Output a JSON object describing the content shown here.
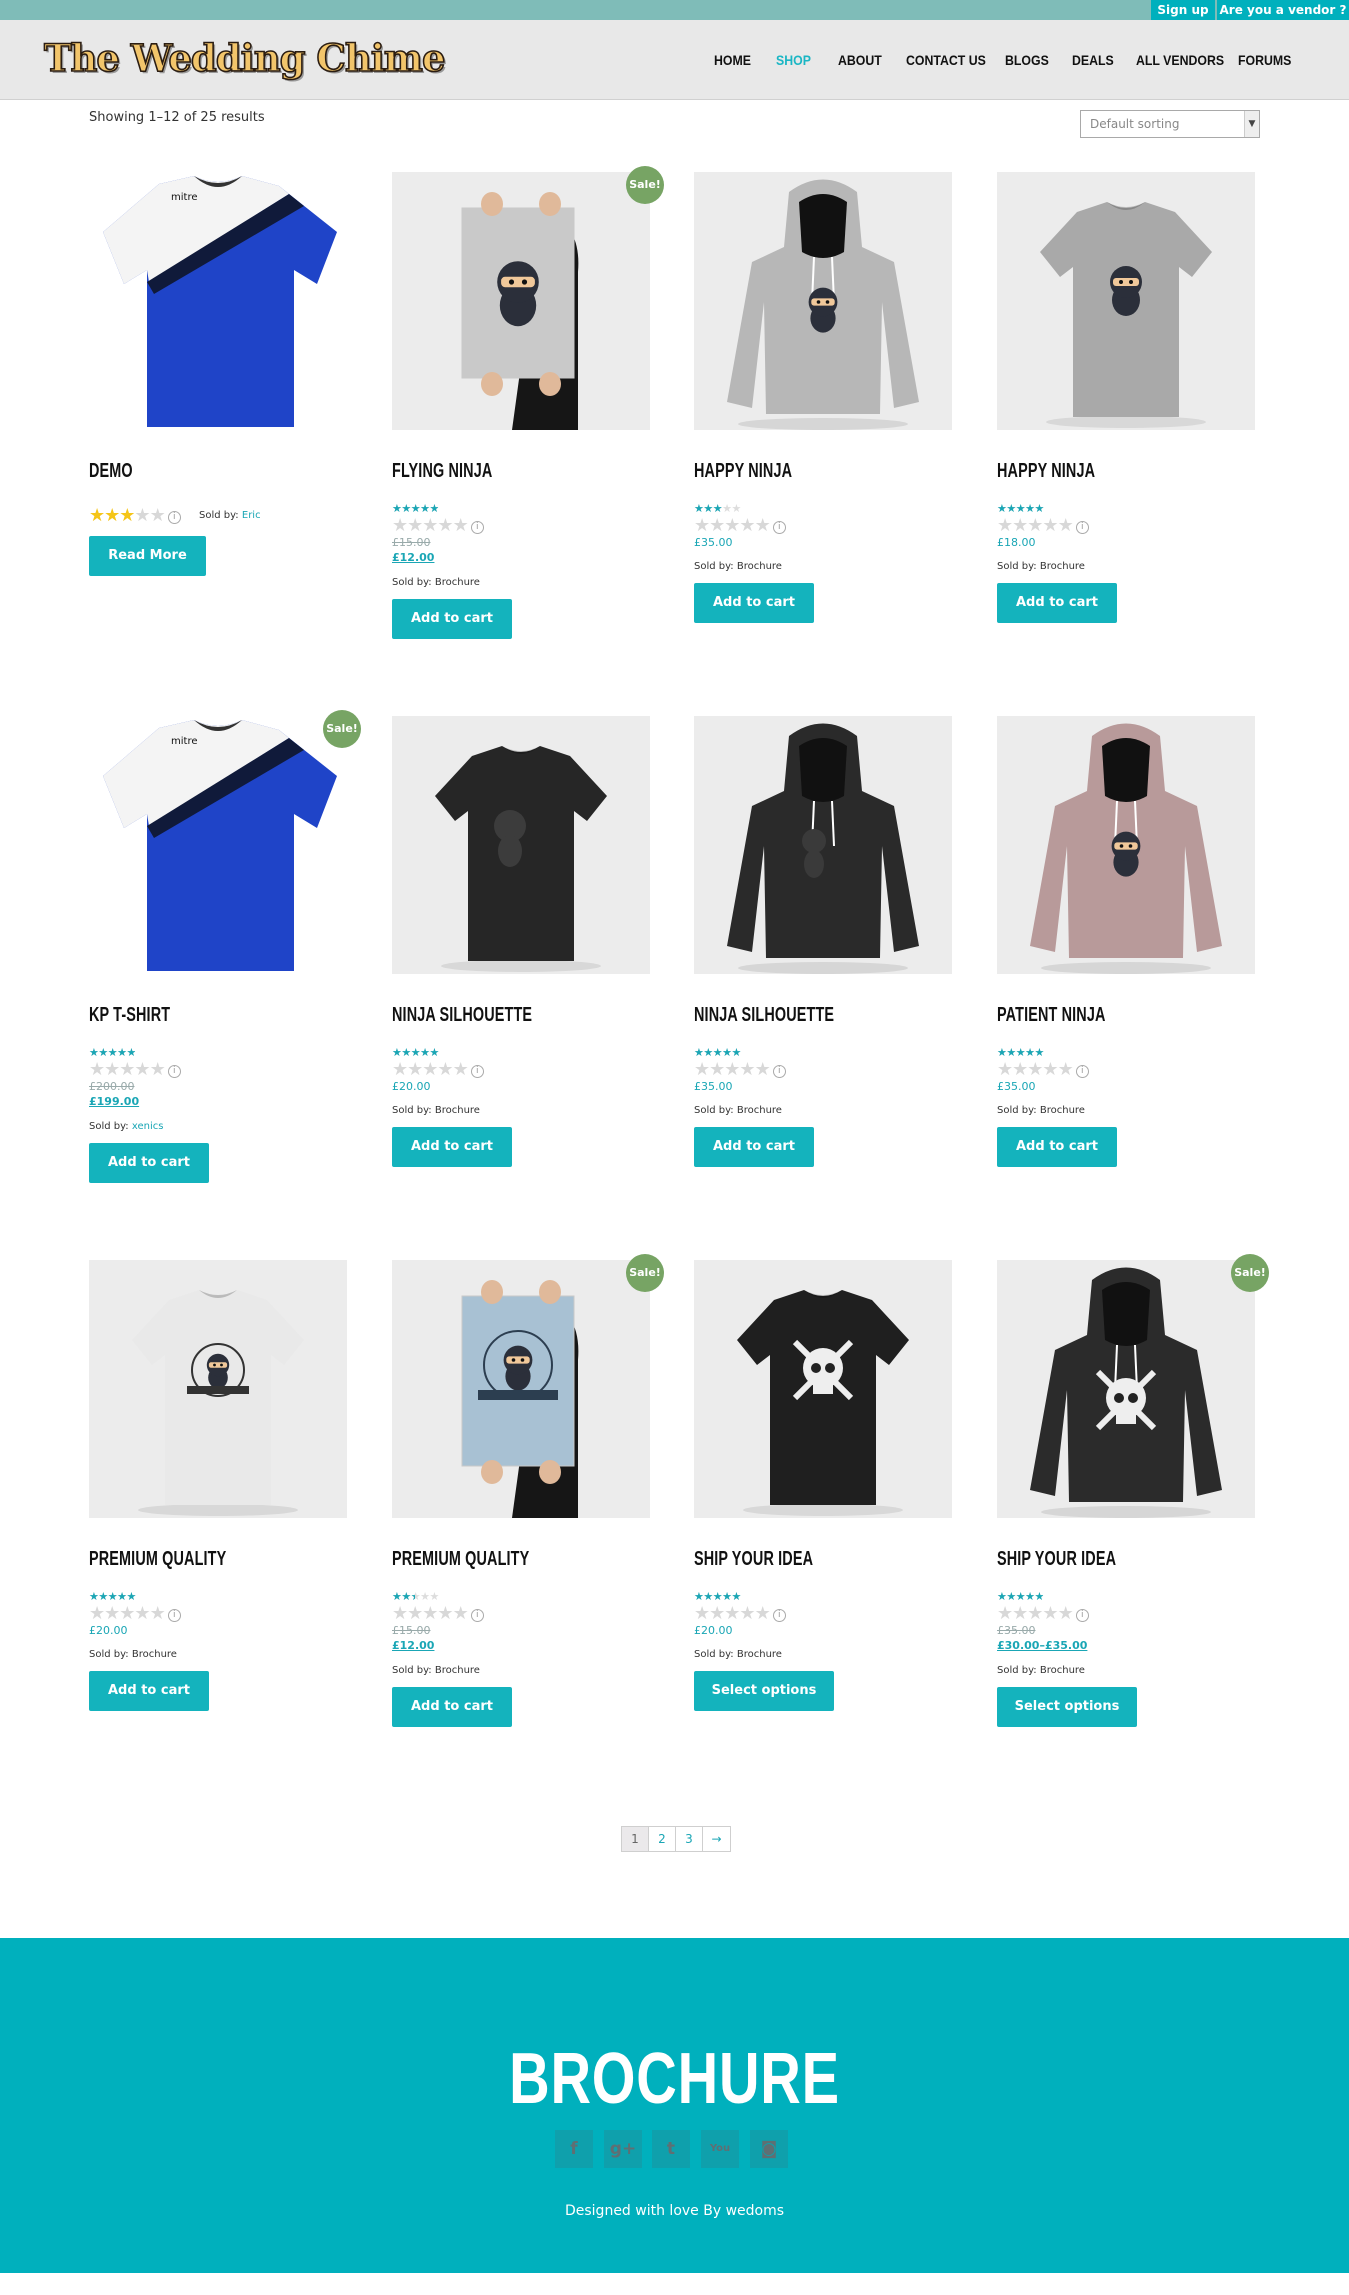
{
  "topbar": {
    "signup": "Sign up",
    "vendor": "Are you a vendor ?"
  },
  "brand": {
    "logo_text": "The Wedding Chime"
  },
  "nav": [
    {
      "label": "HOME",
      "active": false
    },
    {
      "label": "SHOP",
      "active": true
    },
    {
      "label": "ABOUT",
      "active": false
    },
    {
      "label": "CONTACT US",
      "active": false
    },
    {
      "label": "BLOGS",
      "active": false
    },
    {
      "label": "DEALS",
      "active": false
    },
    {
      "label": "ALL VENDORS",
      "active": false
    },
    {
      "label": "FORUMS",
      "active": false
    }
  ],
  "shop": {
    "result_count": "Showing 1–12 of 25 results",
    "sorting": {
      "selected": "Default sorting"
    },
    "sale_badge": "Sale!",
    "sold_by_prefix": "Sold by:"
  },
  "products": [
    {
      "title": "DEMO",
      "image": "blue-jersey",
      "sale": false,
      "rating": 3,
      "rating_style": "gold",
      "price_old": "",
      "price": "",
      "vendor": "Eric",
      "button": "Read More"
    },
    {
      "title": "FLYING NINJA",
      "image": "ninja-poster",
      "sale": true,
      "rating": 4,
      "price_old": "£15.00",
      "price": "£12.00",
      "vendor": "Brochure",
      "button": "Add to cart"
    },
    {
      "title": "HAPPY NINJA",
      "image": "grey-hoodie",
      "sale": false,
      "rating": 2.5,
      "price_old": "",
      "price": "£35.00",
      "vendor": "Brochure",
      "button": "Add to cart"
    },
    {
      "title": "HAPPY NINJA",
      "image": "grey-tshirt",
      "sale": false,
      "rating": 5,
      "price_old": "",
      "price": "£18.00",
      "vendor": "Brochure",
      "button": "Add to cart"
    },
    {
      "title": "KP T-SHIRT",
      "image": "blue-jersey",
      "sale": true,
      "rating": 4,
      "price_old": "£200.00",
      "price": "£199.00",
      "vendor": "xenics",
      "button": "Add to cart"
    },
    {
      "title": "NINJA SILHOUETTE",
      "image": "black-tshirt-ninja",
      "sale": false,
      "rating": 5,
      "price_old": "",
      "price": "£20.00",
      "vendor": "Brochure",
      "button": "Add to cart"
    },
    {
      "title": "NINJA SILHOUETTE",
      "image": "black-hoodie",
      "sale": false,
      "rating": 4.5,
      "price_old": "",
      "price": "£35.00",
      "vendor": "Brochure",
      "button": "Add to cart"
    },
    {
      "title": "PATIENT NINJA",
      "image": "pink-hoodie",
      "sale": false,
      "rating": 5,
      "price_old": "",
      "price": "£35.00",
      "vendor": "Brochure",
      "button": "Add to cart"
    },
    {
      "title": "PREMIUM QUALITY",
      "image": "white-tshirt",
      "sale": false,
      "rating": 4.5,
      "price_old": "",
      "price": "£20.00",
      "vendor": "Brochure",
      "button": "Add to cart"
    },
    {
      "title": "PREMIUM QUALITY",
      "image": "woo-poster",
      "sale": true,
      "rating": 2,
      "price_old": "£15.00",
      "price": "£12.00",
      "vendor": "Brochure",
      "button": "Add to cart"
    },
    {
      "title": "SHIP YOUR IDEA",
      "image": "black-tshirt-skull",
      "sale": false,
      "rating": 4.5,
      "price_old": "",
      "price": "£20.00",
      "vendor": "Brochure",
      "button": "Select options"
    },
    {
      "title": "SHIP YOUR IDEA",
      "image": "black-hoodie-skull",
      "sale": true,
      "rating": 4,
      "price_old": "£35.00",
      "price": "£30.00–£35.00",
      "vendor": "Brochure",
      "button": "Select options"
    }
  ],
  "pagination": [
    "1",
    "2",
    "3",
    "→"
  ],
  "footer": {
    "brand": "BROCHURE",
    "social": [
      {
        "icon": "facebook-icon",
        "glyph": "f"
      },
      {
        "icon": "google-plus-icon",
        "glyph": "g+"
      },
      {
        "icon": "twitter-icon",
        "glyph": "t"
      },
      {
        "icon": "youtube-icon",
        "glyph": "You"
      },
      {
        "icon": "instagram-icon",
        "glyph": "◙"
      }
    ],
    "credit": "Designed with love By wedoms"
  },
  "colors": {
    "accent": "#00b0bd",
    "sale": "#77a464",
    "topbar": "#7fbcb8"
  }
}
